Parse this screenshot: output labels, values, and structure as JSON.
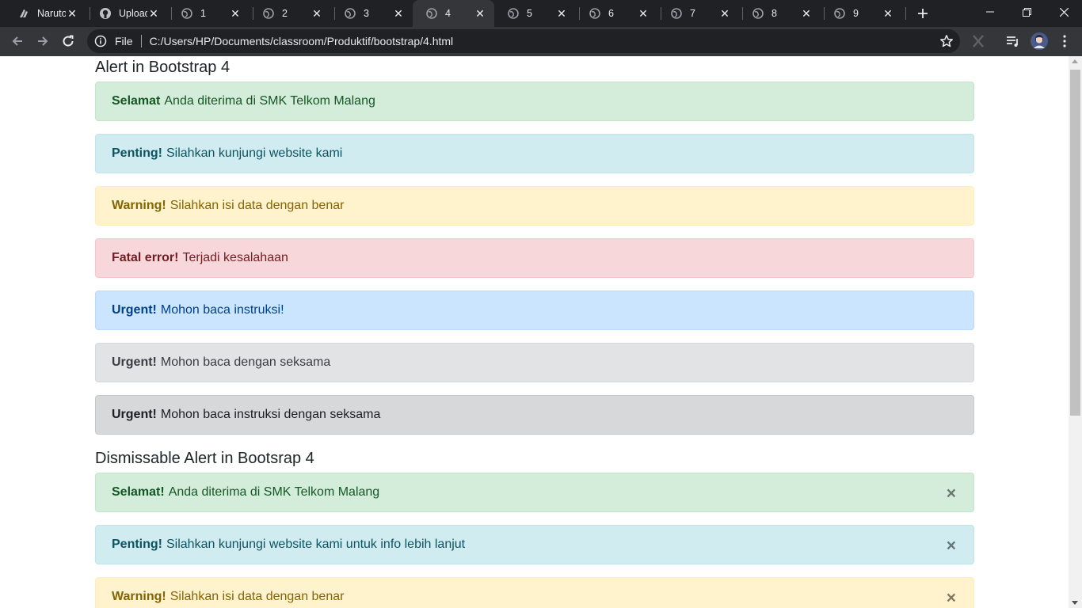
{
  "browser": {
    "tabs": [
      {
        "title": "Naruto",
        "icon": "naruto-icon"
      },
      {
        "title": "Upload",
        "icon": "github-icon"
      },
      {
        "title": "1",
        "icon": "globe-icon"
      },
      {
        "title": "2",
        "icon": "globe-icon"
      },
      {
        "title": "3",
        "icon": "globe-icon"
      },
      {
        "title": "4",
        "icon": "globe-icon",
        "active": true
      },
      {
        "title": "5",
        "icon": "globe-icon"
      },
      {
        "title": "6",
        "icon": "globe-icon"
      },
      {
        "title": "7",
        "icon": "globe-icon"
      },
      {
        "title": "8",
        "icon": "globe-icon"
      },
      {
        "title": "9",
        "icon": "globe-icon"
      }
    ],
    "omnibox": {
      "scheme_label": "File",
      "url": "C:/Users/HP/Documents/classroom/Produktif/bootstrap/4.html"
    }
  },
  "page": {
    "section1_title": "Alert in Bootstrap 4",
    "alerts": [
      {
        "strong": "Selamat",
        "text": "Anda diterima di SMK Telkom Malang",
        "variant": "success"
      },
      {
        "strong": "Penting!",
        "text": "Silahkan kunjungi website kami",
        "variant": "info"
      },
      {
        "strong": "Warning!",
        "text": "Silahkan isi data dengan benar",
        "variant": "warning"
      },
      {
        "strong": "Fatal error!",
        "text": "Terjadi kesalahaan",
        "variant": "danger"
      },
      {
        "strong": "Urgent!",
        "text": "Mohon baca instruksi!",
        "variant": "primary"
      },
      {
        "strong": "Urgent!",
        "text": "Mohon baca dengan seksama",
        "variant": "secondary"
      },
      {
        "strong": "Urgent!",
        "text": "Mohon baca instruksi dengan seksama",
        "variant": "dark"
      }
    ],
    "section2_title": "Dismissable Alert in Bootsrap 4",
    "dismissable_alerts": [
      {
        "strong": "Selamat!",
        "text": "Anda diterima di SMK Telkom Malang",
        "variant": "success"
      },
      {
        "strong": "Penting!",
        "text": "Silahkan kunjungi website kami untuk info lebih lanjut",
        "variant": "info"
      },
      {
        "strong": "Warning!",
        "text": "Silahkan isi data dengan benar",
        "variant": "warning"
      }
    ],
    "close_glyph": "×"
  },
  "colors": {
    "success": "#d4edda",
    "info": "#d1ecf1",
    "warning": "#fff3cd",
    "danger": "#f8d7da",
    "primary": "#cce5ff",
    "secondary": "#e2e3e5",
    "dark": "#d6d8d9"
  }
}
